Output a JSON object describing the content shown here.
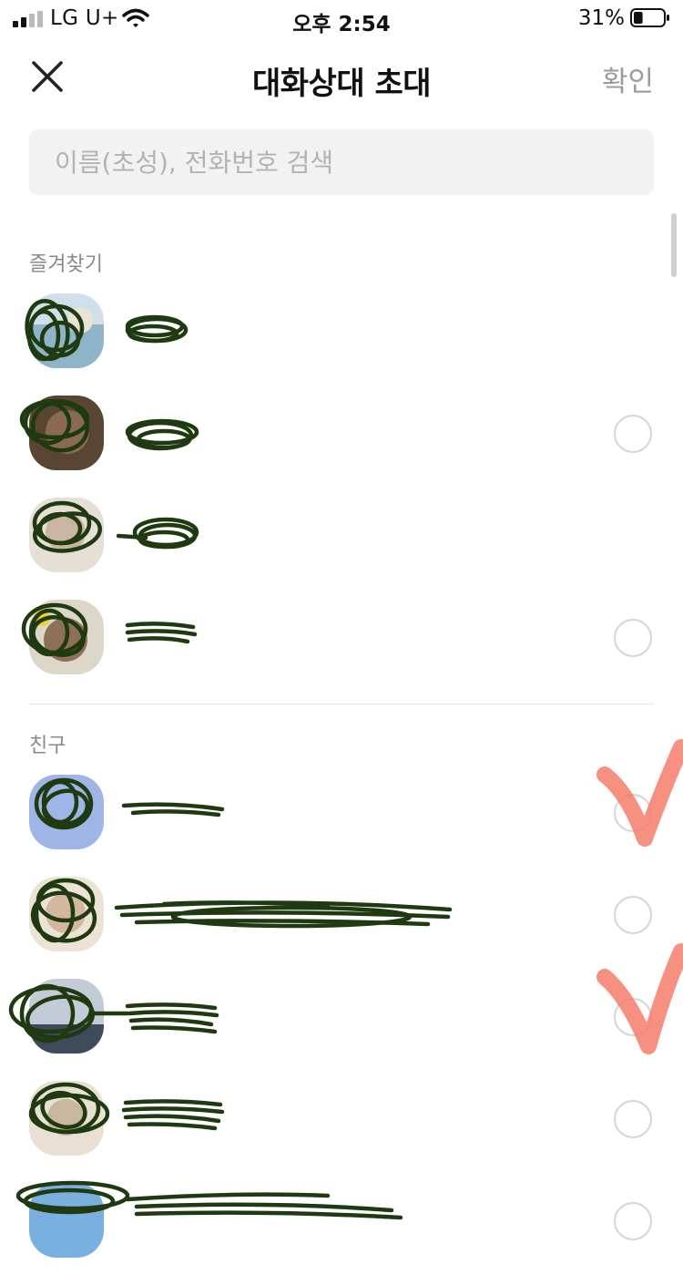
{
  "status_bar": {
    "carrier": "LG U+",
    "time": "오후 2:54",
    "battery": "31%",
    "battery_level": 0.31
  },
  "header": {
    "title": "대화상대 초대",
    "confirm_label": "확인"
  },
  "search": {
    "placeholder": "이름(초성), 전화번호 검색",
    "value": ""
  },
  "sections": {
    "favorites_label": "즐겨찾기",
    "friends_label": "친구"
  },
  "favorites": [
    {
      "selectable": false
    },
    {
      "selectable": true,
      "selected": false
    },
    {
      "selectable": false
    },
    {
      "selectable": true,
      "selected": false
    }
  ],
  "friends": [
    {
      "selectable": true,
      "hand_checked": true
    },
    {
      "selectable": true,
      "hand_checked": false
    },
    {
      "selectable": true,
      "hand_checked": true
    },
    {
      "selectable": true,
      "hand_checked": false
    },
    {
      "selectable": true,
      "hand_checked": false
    }
  ],
  "colors": {
    "scribble": "#1f3a10",
    "check_mark": "#f47c6a",
    "radio_border": "#d6d6d6",
    "search_bg": "#f2f2f2"
  }
}
